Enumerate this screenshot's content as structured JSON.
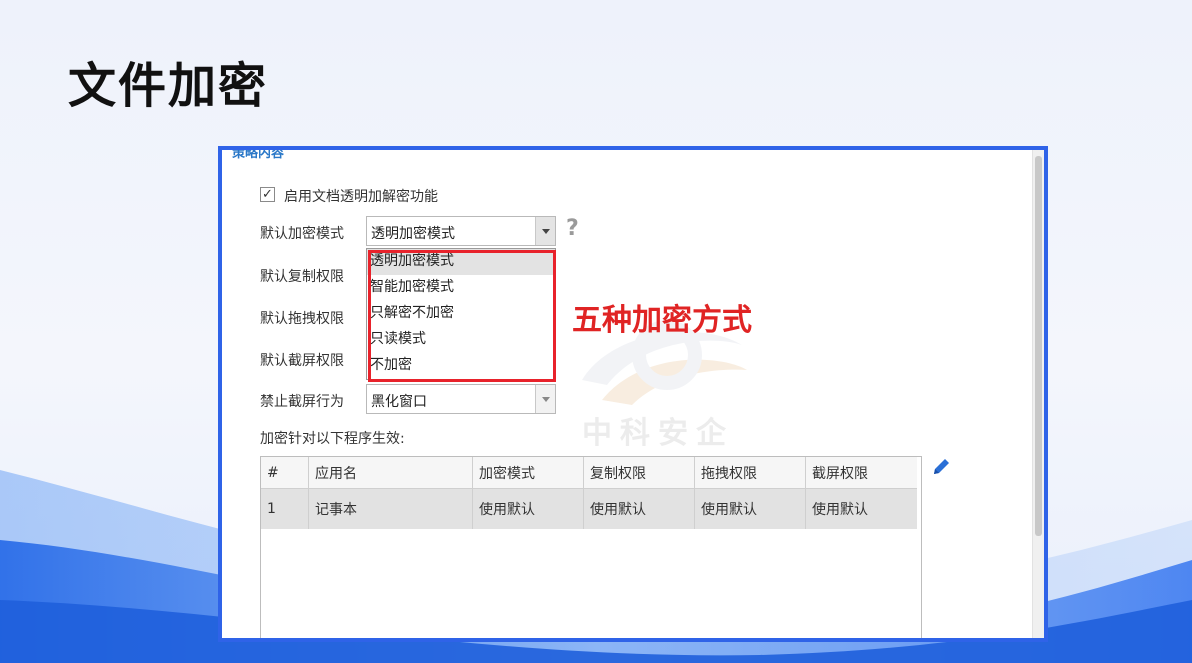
{
  "slide": {
    "title": "文件加密"
  },
  "colors": {
    "frame_border": "#2f63e8",
    "highlight_red": "#e8222b",
    "annotation_red": "#e02424"
  },
  "panel": {
    "section_title": "策略内容",
    "enable_checkbox": {
      "checked": true,
      "check_mark": "✓",
      "label": "启用文档透明加解密功能"
    },
    "labels": {
      "encrypt_mode": "默认加密模式",
      "copy_perm": "默认复制权限",
      "drag_perm": "默认拖拽权限",
      "screenshot_perm": "默认截屏权限",
      "forbid_screenshot": "禁止截屏行为",
      "programs": "加密针对以下程序生效:"
    },
    "encrypt_mode_select": {
      "value": "透明加密模式"
    },
    "help_icon": "?",
    "dropdown_options": [
      "透明加密模式",
      "智能加密模式",
      "只解密不加密",
      "只读模式",
      "不加密"
    ],
    "forbid_screenshot_select": {
      "value": "黑化窗口"
    },
    "annotation": "五种加密方式",
    "watermark": "中科安企",
    "table": {
      "columns": [
        "#",
        "应用名",
        "加密模式",
        "复制权限",
        "拖拽权限",
        "截屏权限"
      ],
      "rows": [
        [
          "1",
          "记事本",
          "使用默认",
          "使用默认",
          "使用默认",
          "使用默认"
        ]
      ]
    },
    "edit_icon": "pencil-icon"
  }
}
